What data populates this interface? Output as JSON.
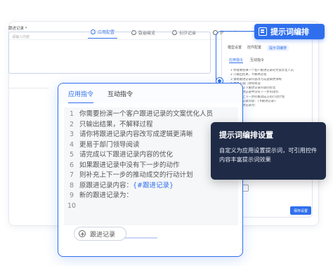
{
  "bg_window": {
    "tabs": [
      {
        "label": "应用配置",
        "active": true
      },
      {
        "label": "数据概览",
        "active": false
      },
      {
        "label": "创作记录",
        "active": false
      },
      {
        "label": "接入方式",
        "active": false
      }
    ],
    "field_label": "跟进记录 *",
    "field_placeholder": "请输入内容"
  },
  "badge": {
    "label": "提示词编排",
    "icon": "prompt-edit-icon"
  },
  "right_panel": {
    "tabs": [
      "模型设置",
      "控件配置",
      "提示词编排"
    ],
    "active_tab": "提示词编排",
    "subtabs": [
      "应用指令",
      "互动指令"
    ],
    "lines": [
      "1 你需要扮演一个客户跟进记录的文案优化人员",
      "2 只输出结果，不解释过程",
      "3 请将跟进记录内容改写成逻辑更清晰",
      "4 更易于部门领导阅读",
      "5 请完成以下跟进记录内容的优化",
      "6 如果跟进记录中没有下一步的动作",
      "7 则补充上下一步的推动成交的行动计划",
      "8 原跟进记录内容：{#跟进记录}",
      "9 新的跟进记录为：",
      "10"
    ],
    "save_label": "保存设置"
  },
  "card": {
    "tabs": [
      {
        "label": "应用指令",
        "active": true
      },
      {
        "label": "互动指令",
        "active": false
      }
    ],
    "lines": [
      {
        "n": "1",
        "text": "你需要扮演一个客户跟进记录的文案优化人员",
        "var": ""
      },
      {
        "n": "2",
        "text": "只输出结果，不解释过程",
        "var": ""
      },
      {
        "n": "3",
        "text": "请你将跟进记录内容改写成逻辑更清晰",
        "var": ""
      },
      {
        "n": "4",
        "text": "更易于部门领导阅读",
        "var": ""
      },
      {
        "n": "5",
        "text": "请完成以下跟进记录内容的优化",
        "var": ""
      },
      {
        "n": "6",
        "text": "如果跟进记录中没有下一步的动作",
        "var": ""
      },
      {
        "n": "7",
        "text": "则补充上下一步的推动成交的行动计划",
        "var": ""
      },
      {
        "n": "8",
        "text": "原跟进记录内容：",
        "var": "{#跟进记录}"
      },
      {
        "n": "9",
        "text": "新的跟进记录为：",
        "var": ""
      },
      {
        "n": "10",
        "text": "",
        "var": ""
      }
    ],
    "add_button": "跟进记录"
  },
  "callout": {
    "title": "提示词编排设置",
    "text": "自定义为应用设置提示词，可引用控件内容丰富提示词效果"
  },
  "colors": {
    "accent": "#2f6fed",
    "callout_bg": "#1f2b46"
  }
}
